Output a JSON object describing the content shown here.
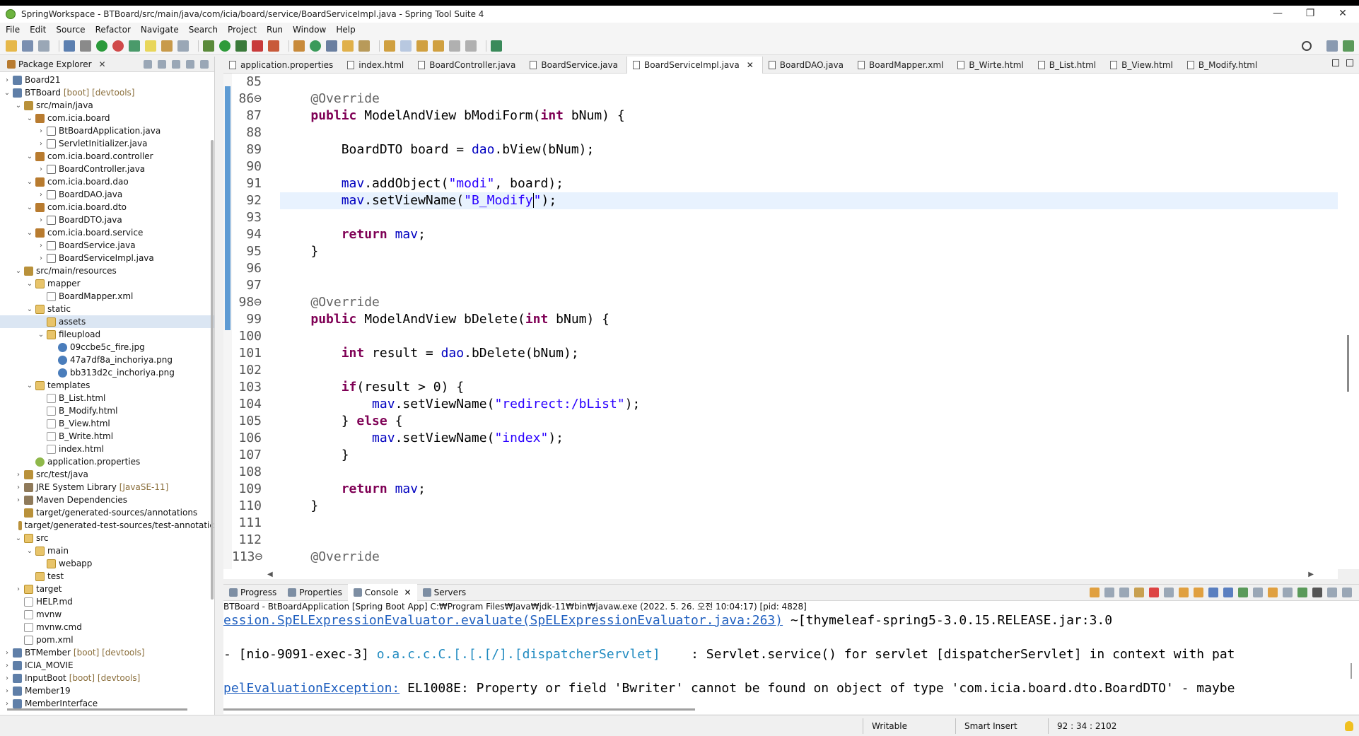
{
  "window": {
    "title": "SpringWorkspace - BTBoard/src/main/java/com/icia/board/service/BoardServiceImpl.java - Spring Tool Suite 4",
    "controls": [
      "—",
      "❐",
      "✕"
    ]
  },
  "menu": [
    "File",
    "Edit",
    "Source",
    "Refactor",
    "Navigate",
    "Search",
    "Project",
    "Run",
    "Window",
    "Help"
  ],
  "explorer": {
    "tab_label": "Package Explorer",
    "tree": [
      {
        "indent": 0,
        "arrow": "›",
        "icon": "proj",
        "label": "Board21",
        "extra": ""
      },
      {
        "indent": 0,
        "arrow": "⌄",
        "icon": "proj",
        "label": "BTBoard",
        "extra": "[boot] [devtools]"
      },
      {
        "indent": 1,
        "arrow": "⌄",
        "icon": "src",
        "label": "src/main/java",
        "extra": ""
      },
      {
        "indent": 2,
        "arrow": "⌄",
        "icon": "pkg",
        "label": "com.icia.board",
        "extra": ""
      },
      {
        "indent": 3,
        "arrow": "›",
        "icon": "java",
        "label": "BtBoardApplication.java",
        "extra": ""
      },
      {
        "indent": 3,
        "arrow": "›",
        "icon": "java",
        "label": "ServletInitializer.java",
        "extra": ""
      },
      {
        "indent": 2,
        "arrow": "⌄",
        "icon": "pkg",
        "label": "com.icia.board.controller",
        "extra": ""
      },
      {
        "indent": 3,
        "arrow": "›",
        "icon": "java",
        "label": "BoardController.java",
        "extra": ""
      },
      {
        "indent": 2,
        "arrow": "⌄",
        "icon": "pkg",
        "label": "com.icia.board.dao",
        "extra": ""
      },
      {
        "indent": 3,
        "arrow": "›",
        "icon": "java",
        "label": "BoardDAO.java",
        "extra": ""
      },
      {
        "indent": 2,
        "arrow": "⌄",
        "icon": "pkg",
        "label": "com.icia.board.dto",
        "extra": ""
      },
      {
        "indent": 3,
        "arrow": "›",
        "icon": "java",
        "label": "BoardDTO.java",
        "extra": ""
      },
      {
        "indent": 2,
        "arrow": "⌄",
        "icon": "pkg",
        "label": "com.icia.board.service",
        "extra": ""
      },
      {
        "indent": 3,
        "arrow": "›",
        "icon": "java",
        "label": "BoardService.java",
        "extra": ""
      },
      {
        "indent": 3,
        "arrow": "›",
        "icon": "java",
        "label": "BoardServiceImpl.java",
        "extra": ""
      },
      {
        "indent": 1,
        "arrow": "⌄",
        "icon": "src",
        "label": "src/main/resources",
        "extra": ""
      },
      {
        "indent": 2,
        "arrow": "⌄",
        "icon": "folder",
        "label": "mapper",
        "extra": ""
      },
      {
        "indent": 3,
        "arrow": "",
        "icon": "xml",
        "label": "BoardMapper.xml",
        "extra": ""
      },
      {
        "indent": 2,
        "arrow": "⌄",
        "icon": "folder",
        "label": "static",
        "extra": ""
      },
      {
        "indent": 3,
        "arrow": "",
        "icon": "folder",
        "label": "assets",
        "extra": "",
        "selected": true
      },
      {
        "indent": 3,
        "arrow": "⌄",
        "icon": "folder",
        "label": "fileupload",
        "extra": ""
      },
      {
        "indent": 4,
        "arrow": "",
        "icon": "img",
        "label": "09ccbe5c_fire.jpg",
        "extra": ""
      },
      {
        "indent": 4,
        "arrow": "",
        "icon": "img",
        "label": "47a7df8a_inchoriya.png",
        "extra": ""
      },
      {
        "indent": 4,
        "arrow": "",
        "icon": "img",
        "label": "bb313d2c_inchoriya.png",
        "extra": ""
      },
      {
        "indent": 2,
        "arrow": "⌄",
        "icon": "folder",
        "label": "templates",
        "extra": ""
      },
      {
        "indent": 3,
        "arrow": "",
        "icon": "file",
        "label": "B_List.html",
        "extra": ""
      },
      {
        "indent": 3,
        "arrow": "",
        "icon": "file",
        "label": "B_Modify.html",
        "extra": ""
      },
      {
        "indent": 3,
        "arrow": "",
        "icon": "file",
        "label": "B_View.html",
        "extra": ""
      },
      {
        "indent": 3,
        "arrow": "",
        "icon": "file",
        "label": "B_Write.html",
        "extra": ""
      },
      {
        "indent": 3,
        "arrow": "",
        "icon": "file",
        "label": "index.html",
        "extra": ""
      },
      {
        "indent": 2,
        "arrow": "",
        "icon": "prop",
        "label": "application.properties",
        "extra": ""
      },
      {
        "indent": 1,
        "arrow": "›",
        "icon": "src",
        "label": "src/test/java",
        "extra": ""
      },
      {
        "indent": 1,
        "arrow": "›",
        "icon": "lib",
        "label": "JRE System Library",
        "extra": "[JavaSE-11]"
      },
      {
        "indent": 1,
        "arrow": "›",
        "icon": "lib",
        "label": "Maven Dependencies",
        "extra": ""
      },
      {
        "indent": 1,
        "arrow": "",
        "icon": "src",
        "label": "target/generated-sources/annotations",
        "extra": ""
      },
      {
        "indent": 1,
        "arrow": "",
        "icon": "src",
        "label": "target/generated-test-sources/test-annotatic",
        "extra": ""
      },
      {
        "indent": 1,
        "arrow": "⌄",
        "icon": "folder",
        "label": "src",
        "extra": ""
      },
      {
        "indent": 2,
        "arrow": "⌄",
        "icon": "folder",
        "label": "main",
        "extra": ""
      },
      {
        "indent": 3,
        "arrow": "",
        "icon": "folder",
        "label": "webapp",
        "extra": ""
      },
      {
        "indent": 2,
        "arrow": "",
        "icon": "folder",
        "label": "test",
        "extra": ""
      },
      {
        "indent": 1,
        "arrow": "›",
        "icon": "folder",
        "label": "target",
        "extra": ""
      },
      {
        "indent": 1,
        "arrow": "",
        "icon": "file",
        "label": "HELP.md",
        "extra": ""
      },
      {
        "indent": 1,
        "arrow": "",
        "icon": "file",
        "label": "mvnw",
        "extra": ""
      },
      {
        "indent": 1,
        "arrow": "",
        "icon": "file",
        "label": "mvnw.cmd",
        "extra": ""
      },
      {
        "indent": 1,
        "arrow": "",
        "icon": "xml",
        "label": "pom.xml",
        "extra": ""
      },
      {
        "indent": 0,
        "arrow": "›",
        "icon": "proj",
        "label": "BTMember",
        "extra": "[boot] [devtools]"
      },
      {
        "indent": 0,
        "arrow": "›",
        "icon": "proj",
        "label": "ICIA_MOVIE",
        "extra": ""
      },
      {
        "indent": 0,
        "arrow": "›",
        "icon": "proj",
        "label": "InputBoot",
        "extra": "[boot] [devtools]"
      },
      {
        "indent": 0,
        "arrow": "›",
        "icon": "proj",
        "label": "Member19",
        "extra": ""
      },
      {
        "indent": 0,
        "arrow": "›",
        "icon": "proj",
        "label": "MemberInterface",
        "extra": ""
      }
    ]
  },
  "editor": {
    "tabs": [
      {
        "label": "application.properties",
        "active": false
      },
      {
        "label": "index.html",
        "active": false
      },
      {
        "label": "BoardController.java",
        "active": false
      },
      {
        "label": "BoardService.java",
        "active": false
      },
      {
        "label": "BoardServiceImpl.java",
        "active": true
      },
      {
        "label": "BoardDAO.java",
        "active": false
      },
      {
        "label": "BoardMapper.xml",
        "active": false
      },
      {
        "label": "B_Wirte.html",
        "active": false
      },
      {
        "label": "B_List.html",
        "active": false
      },
      {
        "label": "B_View.html",
        "active": false
      },
      {
        "label": "B_Modify.html",
        "active": false
      }
    ],
    "close_label": "✕",
    "lines": [
      {
        "n": "85",
        "html": ""
      },
      {
        "n": "86⊖",
        "html": "    <span class=\"ann\">@Override</span>"
      },
      {
        "n": "87",
        "html": "    <span class=\"kw\">public</span> ModelAndView bModiForm(<span class=\"kw\">int</span> bNum) {"
      },
      {
        "n": "88",
        "html": ""
      },
      {
        "n": "89",
        "html": "        BoardDTO board = <span class=\"fld\">dao</span>.bView(bNum);"
      },
      {
        "n": "90",
        "html": ""
      },
      {
        "n": "91",
        "html": "        <span class=\"fld\">mav</span>.addObject(<span class=\"str\">\"modi\"</span>, board);"
      },
      {
        "n": "92",
        "html": "        <span class=\"fld\">mav</span>.setViewName(<span class=\"str\">\"B_Modify<span class=\"cursor\"></span>\"</span>);",
        "current": true
      },
      {
        "n": "93",
        "html": ""
      },
      {
        "n": "94",
        "html": "        <span class=\"kw\">return</span> <span class=\"fld\">mav</span>;"
      },
      {
        "n": "95",
        "html": "    }"
      },
      {
        "n": "96",
        "html": ""
      },
      {
        "n": "97",
        "html": ""
      },
      {
        "n": "98⊖",
        "html": "    <span class=\"ann\">@Override</span>"
      },
      {
        "n": "99",
        "html": "    <span class=\"kw\">public</span> ModelAndView bDelete(<span class=\"kw\">int</span> bNum) {"
      },
      {
        "n": "100",
        "html": ""
      },
      {
        "n": "101",
        "html": "        <span class=\"kw\">int</span> result = <span class=\"fld\">dao</span>.bDelete(bNum);"
      },
      {
        "n": "102",
        "html": ""
      },
      {
        "n": "103",
        "html": "        <span class=\"kw\">if</span>(result > 0) {"
      },
      {
        "n": "104",
        "html": "            <span class=\"fld\">mav</span>.setViewName(<span class=\"str\">\"redirect:/bList\"</span>);"
      },
      {
        "n": "105",
        "html": "        } <span class=\"kw\">else</span> {"
      },
      {
        "n": "106",
        "html": "            <span class=\"fld\">mav</span>.setViewName(<span class=\"str\">\"index\"</span>);"
      },
      {
        "n": "107",
        "html": "        }"
      },
      {
        "n": "108",
        "html": ""
      },
      {
        "n": "109",
        "html": "        <span class=\"kw\">return</span> <span class=\"fld\">mav</span>;"
      },
      {
        "n": "110",
        "html": "    }"
      },
      {
        "n": "111",
        "html": ""
      },
      {
        "n": "112",
        "html": ""
      },
      {
        "n": "113⊖",
        "html": "    <span class=\"ann\">@Override</span>"
      }
    ]
  },
  "console": {
    "tabs": [
      {
        "label": "Progress",
        "active": false
      },
      {
        "label": "Properties",
        "active": false
      },
      {
        "label": "Console",
        "active": true
      },
      {
        "label": "Servers",
        "active": false
      }
    ],
    "header": "BTBoard - BtBoardApplication [Spring Boot App] C:₩Program Files₩Java₩jdk-11₩bin₩javaw.exe  (2022. 5. 26. 오전 10:04:17) [pid: 4828]",
    "lines": [
      "<span class=\"link\">ession.SpELExpressionEvaluator.evaluate(SpELExpressionEvaluator.java:263)</span> ~[thymeleaf-spring5-3.0.15.RELEASE.jar:3.0",
      "",
      "- [nio-9091-exec-3] <span class=\"cblue\">o.a.c.c.C.[.[.[/].[dispatcherServlet]</span>    : Servlet.service() for servlet [dispatcherServlet] in context with pat",
      "",
      "<span class=\"link\">pelEvaluationException:</span> EL1008E: Property or field 'Bwriter' cannot be found on object of type 'com.icia.board.dto.BoardDTO' - maybe"
    ]
  },
  "status": {
    "writable": "Writable",
    "insert_mode": "Smart Insert",
    "position": "92 : 34 : 2102"
  }
}
